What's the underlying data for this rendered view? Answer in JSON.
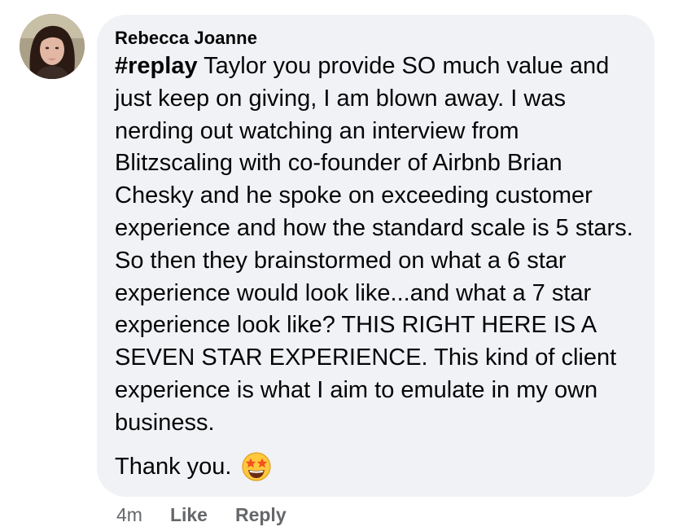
{
  "comment": {
    "author": "Rebecca Joanne",
    "hashtag": "#replay",
    "body": "Taylor you provide SO much value and just keep on giving, I am blown away. I was nerding out watching an interview from Blitzscaling with co-founder of Airbnb Brian Chesky and he spoke on exceeding customer experience and how the standard scale is 5 stars. So then they brainstormed on what a 6 star experience would look like...and what a 7 star experience look like? THIS RIGHT HERE IS A SEVEN STAR EXPERIENCE. This kind of client experience is what I aim to emulate in my own business.",
    "closing": "Thank you.",
    "emoji": "star-struck-emoji"
  },
  "actions": {
    "time": "4m",
    "like_label": "Like",
    "reply_label": "Reply"
  },
  "colors": {
    "bubble": "#f0f2f5",
    "meta_text": "#65676b",
    "emoji_face": "#ffc83d",
    "emoji_star": "#f4511e"
  }
}
